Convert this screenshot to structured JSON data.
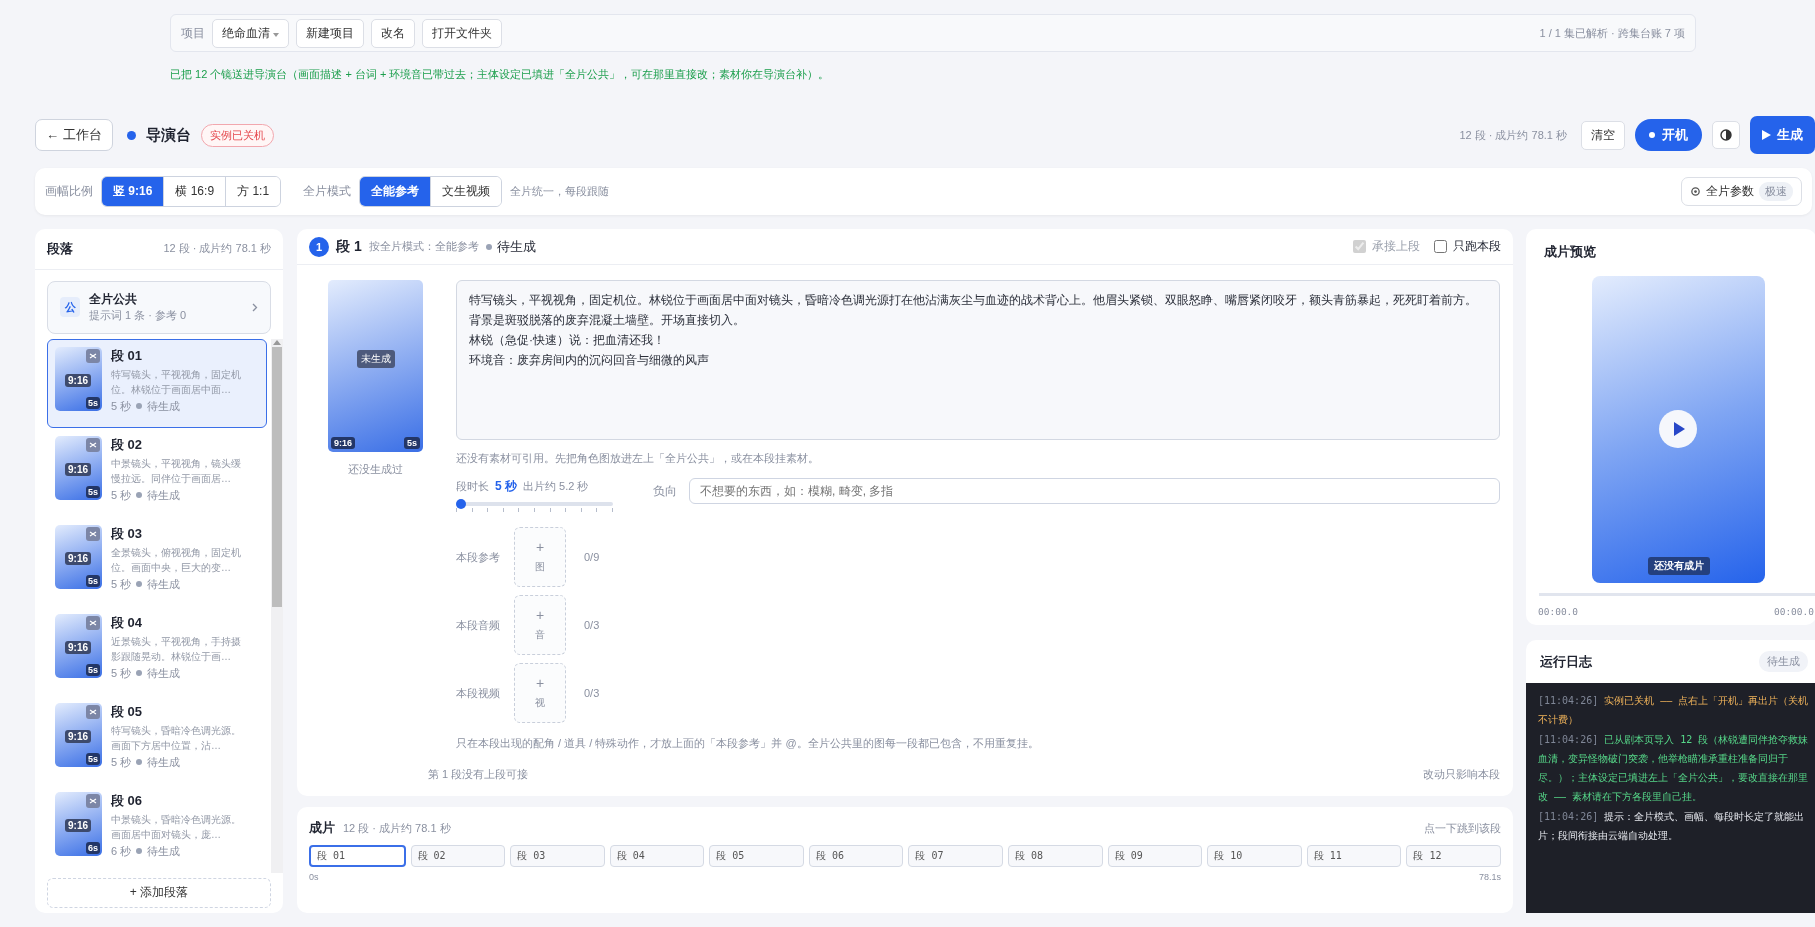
{
  "project_bar": {
    "label": "项目",
    "project": "绝命血清",
    "buttons": [
      "新建项目",
      "改名",
      "打开文件夹"
    ],
    "status": "1 / 1 集已解析 · 跨集台账 7 项"
  },
  "notice": "已把 12 个镜送进导演台（画面描述 + 台词 + 环境音已带过去；主体设定已填进「全片公共」，可在那里直接改；素材你在导演台补）。",
  "header": {
    "back": "← 工作台",
    "title": "导演台",
    "badge": "实例已关机",
    "summary": "12 段 · 成片约 78.1 秒",
    "clear": "清空",
    "power": "开机",
    "generate": "生成"
  },
  "settings": {
    "aspect_label": "画幅比例",
    "aspects": [
      {
        "label": "竖 9:16",
        "selected": true
      },
      {
        "label": "横 16:9",
        "selected": false
      },
      {
        "label": "方 1:1",
        "selected": false
      }
    ],
    "mode_label": "全片模式",
    "modes": [
      {
        "label": "全能参考",
        "selected": true
      },
      {
        "label": "文生视频",
        "selected": false
      }
    ],
    "mode_hint": "全片统一，每段跟随",
    "params": "全片参数",
    "speed": "极速"
  },
  "segments_panel": {
    "title": "段落",
    "summary": "12 段 · 成片约 78.1 秒",
    "public": {
      "badge": "公",
      "title": "全片公共",
      "subtitle": "提示词 1 条 · 参考 0"
    },
    "items": [
      {
        "title": "段 01",
        "desc": "特写镜头，平视视角，固定机位。林锐位于画面居中面…",
        "ratio": "9:16",
        "clip": "5s",
        "duration": "5 秒",
        "status": "待生成",
        "selected": true
      },
      {
        "title": "段 02",
        "desc": "中景镜头，平视视角，镜头缓慢拉远。同伴位于画面居…",
        "ratio": "9:16",
        "clip": "5s",
        "duration": "5 秒",
        "status": "待生成",
        "selected": false
      },
      {
        "title": "段 03",
        "desc": "全景镜头，俯视视角，固定机位。画面中央，巨大的变…",
        "ratio": "9:16",
        "clip": "5s",
        "duration": "5 秒",
        "status": "待生成",
        "selected": false
      },
      {
        "title": "段 04",
        "desc": "近景镜头，平视视角，手持摄影跟随晃动。林锐位于画…",
        "ratio": "9:16",
        "clip": "5s",
        "duration": "5 秒",
        "status": "待生成",
        "selected": false
      },
      {
        "title": "段 05",
        "desc": "特写镜头，昏暗冷色调光源。画面下方居中位置，沾…",
        "ratio": "9:16",
        "clip": "5s",
        "duration": "5 秒",
        "status": "待生成",
        "selected": false
      },
      {
        "title": "段 06",
        "desc": "中景镜头，昏暗冷色调光源。画面居中面对镜头，庞…",
        "ratio": "9:16",
        "clip": "6s",
        "duration": "6 秒",
        "status": "待生成",
        "selected": false
      }
    ],
    "add": "+ 添加段落"
  },
  "editor": {
    "index": "1",
    "title": "段 1",
    "mode_note": "按全片模式：全能参考",
    "status": "待生成",
    "carry_over": {
      "label": "承接上段",
      "checked": true,
      "disabled": true
    },
    "solo": {
      "label": "只跑本段",
      "checked": false,
      "disabled": false
    },
    "thumb": {
      "state": "未生成",
      "ratio": "9:16",
      "clip": "5s",
      "caption": "还没生成过"
    },
    "prompt": [
      "特写镜头，平视视角，固定机位。林锐位于画面居中面对镜头，昏暗冷色调光源打在他沾满灰尘与血迹的战术背心上。他眉头紧锁、双眼怒睁、嘴唇紧闭咬牙，额头青筋暴起，死死盯着前方。背景是斑驳脱落的废弃混凝土墙壁。开场直接切入。",
      "林锐（急促·快速）说：把血清还我！",
      "环境音：废弃房间内的沉闷回音与细微的风声"
    ],
    "ref_hint": "还没有素材可引用。先把角色图放进左上「全片公共」，或在本段挂素材。",
    "duration": {
      "label": "段时长",
      "value": "5 秒",
      "output": "出片约 5.2 秒",
      "level": 0
    },
    "negative": {
      "label": "负向",
      "placeholder": "不想要的东西，如：模糊, 畸变, 多指"
    },
    "uploads": [
      {
        "label": "本段参考",
        "plus": "+",
        "type": "图",
        "count": "0/9"
      },
      {
        "label": "本段音频",
        "plus": "+",
        "type": "音",
        "count": "0/3"
      },
      {
        "label": "本段视频",
        "plus": "+",
        "type": "视",
        "count": "0/3"
      }
    ],
    "tip": "只在本段出现的配角 / 道具 / 特殊动作，才放上面的「本段参考」并 @。全片公共里的图每一段都已包含，不用重复挂。",
    "footer_left": "第 1 段没有上段可接",
    "footer_right": "改动只影响本段"
  },
  "timeline": {
    "title": "成片",
    "summary": "12 段 · 成片约 78.1 秒",
    "hint": "点一下跳到该段",
    "chips": [
      {
        "label": "段 01",
        "selected": true
      },
      {
        "label": "段 02",
        "selected": false
      },
      {
        "label": "段 03",
        "selected": false
      },
      {
        "label": "段 04",
        "selected": false
      },
      {
        "label": "段 05",
        "selected": false
      },
      {
        "label": "段 06",
        "selected": false
      },
      {
        "label": "段 07",
        "selected": false
      },
      {
        "label": "段 08",
        "selected": false
      },
      {
        "label": "段 09",
        "selected": false
      },
      {
        "label": "段 10",
        "selected": false
      },
      {
        "label": "段 11",
        "selected": false
      },
      {
        "label": "段 12",
        "selected": false
      }
    ],
    "start": "0s",
    "end": "78.1s"
  },
  "preview": {
    "title": "成片预览",
    "empty": "还没有成片",
    "time_start": "00:00.0",
    "time_end": "00:00.0"
  },
  "log": {
    "title": "运行日志",
    "status": "待生成",
    "entries": [
      {
        "time": "[11:04:26]",
        "text": "实例已关机 —— 点右上「开机」再出片（关机不计费）",
        "kind": "warn"
      },
      {
        "time": "[11:04:26]",
        "text": "已从剧本页导入 12 段（林锐遭同伴抢夺救妹血清，变异怪物破门突袭，他举枪瞄准承重柱准备同归于尽。）；主体设定已填进左上「全片公共」，要改直接在那里改 —— 素材请在下方各段里自己挂。",
        "kind": "success"
      },
      {
        "time": "[11:04:26]",
        "text": "提示：全片模式、画幅、每段时长定了就能出片；段间衔接由云端自动处理。",
        "kind": "info"
      }
    ]
  }
}
